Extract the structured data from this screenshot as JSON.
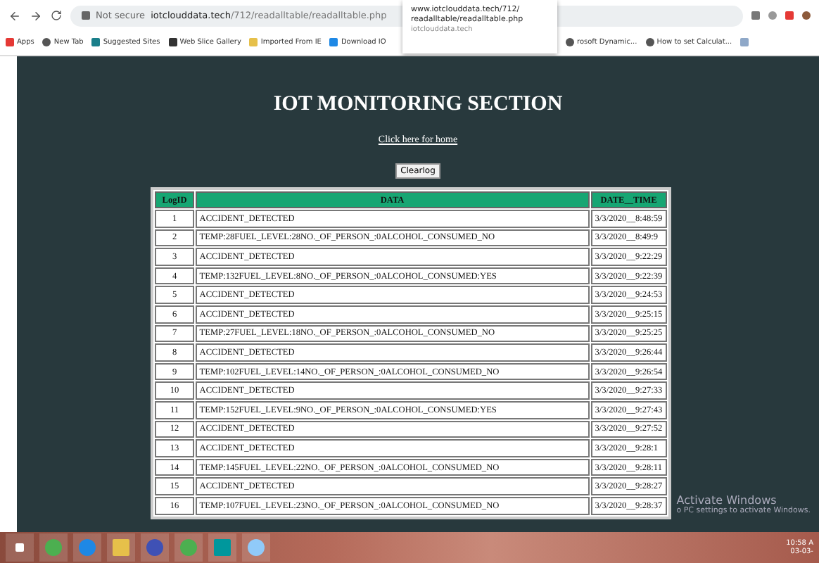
{
  "browser": {
    "security": "Not secure",
    "url_domain": "iotclouddata.tech",
    "url_path": "/712/readalltable/readalltable.php",
    "bookmarks_left": [
      "Apps",
      "New Tab",
      "Suggested Sites",
      "Web Slice Gallery",
      "Imported From IE",
      "Download IO"
    ],
    "bookmarks_right": [
      "rosoft Dynamic...",
      "How to set Calculat..."
    ],
    "tooltip": {
      "lines": [
        "www.iotclouddata.tech/712/",
        "readalltable/readalltable.php"
      ],
      "domain": "iotclouddata.tech"
    }
  },
  "page": {
    "title": "IOT MONITORING SECTION",
    "home_link": "Click here for home",
    "clear_button": "Clearlog"
  },
  "table": {
    "columns": [
      "LogID",
      "DATA",
      "DATE__TIME"
    ],
    "rows": [
      [
        "1",
        "ACCIDENT_DETECTED",
        "3/3/2020__8:48:59"
      ],
      [
        "2",
        "TEMP:28FUEL_LEVEL:28NO._OF_PERSON_:0ALCOHOL_CONSUMED_NO",
        "3/3/2020__8:49:9"
      ],
      [
        "3",
        "ACCIDENT_DETECTED",
        "3/3/2020__9:22:29"
      ],
      [
        "4",
        "TEMP:132FUEL_LEVEL:8NO._OF_PERSON_:0ALCOHOL_CONSUMED:YES",
        "3/3/2020__9:22:39"
      ],
      [
        "5",
        "ACCIDENT_DETECTED",
        "3/3/2020__9:24:53"
      ],
      [
        "6",
        "ACCIDENT_DETECTED",
        "3/3/2020__9:25:15"
      ],
      [
        "7",
        "TEMP:27FUEL_LEVEL:18NO._OF_PERSON_:0ALCOHOL_CONSUMED_NO",
        "3/3/2020__9:25:25"
      ],
      [
        "8",
        "ACCIDENT_DETECTED",
        "3/3/2020__9:26:44"
      ],
      [
        "9",
        "TEMP:102FUEL_LEVEL:14NO._OF_PERSON_:0ALCOHOL_CONSUMED_NO",
        "3/3/2020__9:26:54"
      ],
      [
        "10",
        "ACCIDENT_DETECTED",
        "3/3/2020__9:27:33"
      ],
      [
        "11",
        "TEMP:152FUEL_LEVEL:9NO._OF_PERSON_:0ALCOHOL_CONSUMED:YES",
        "3/3/2020__9:27:43"
      ],
      [
        "12",
        "ACCIDENT_DETECTED",
        "3/3/2020__9:27:52"
      ],
      [
        "13",
        "ACCIDENT_DETECTED",
        "3/3/2020__9:28:1"
      ],
      [
        "14",
        "TEMP:145FUEL_LEVEL:22NO._OF_PERSON_:0ALCOHOL_CONSUMED_NO",
        "3/3/2020__9:28:11"
      ],
      [
        "15",
        "ACCIDENT_DETECTED",
        "3/3/2020__9:28:27"
      ],
      [
        "16",
        "TEMP:107FUEL_LEVEL:23NO._OF_PERSON_:0ALCOHOL_CONSUMED_NO",
        "3/3/2020__9:28:37"
      ]
    ]
  },
  "activation": {
    "title": "Activate Windows",
    "note": "o PC settings to activate Windows."
  },
  "taskbar": {
    "time": "10:58 A",
    "date": "03-03-"
  }
}
